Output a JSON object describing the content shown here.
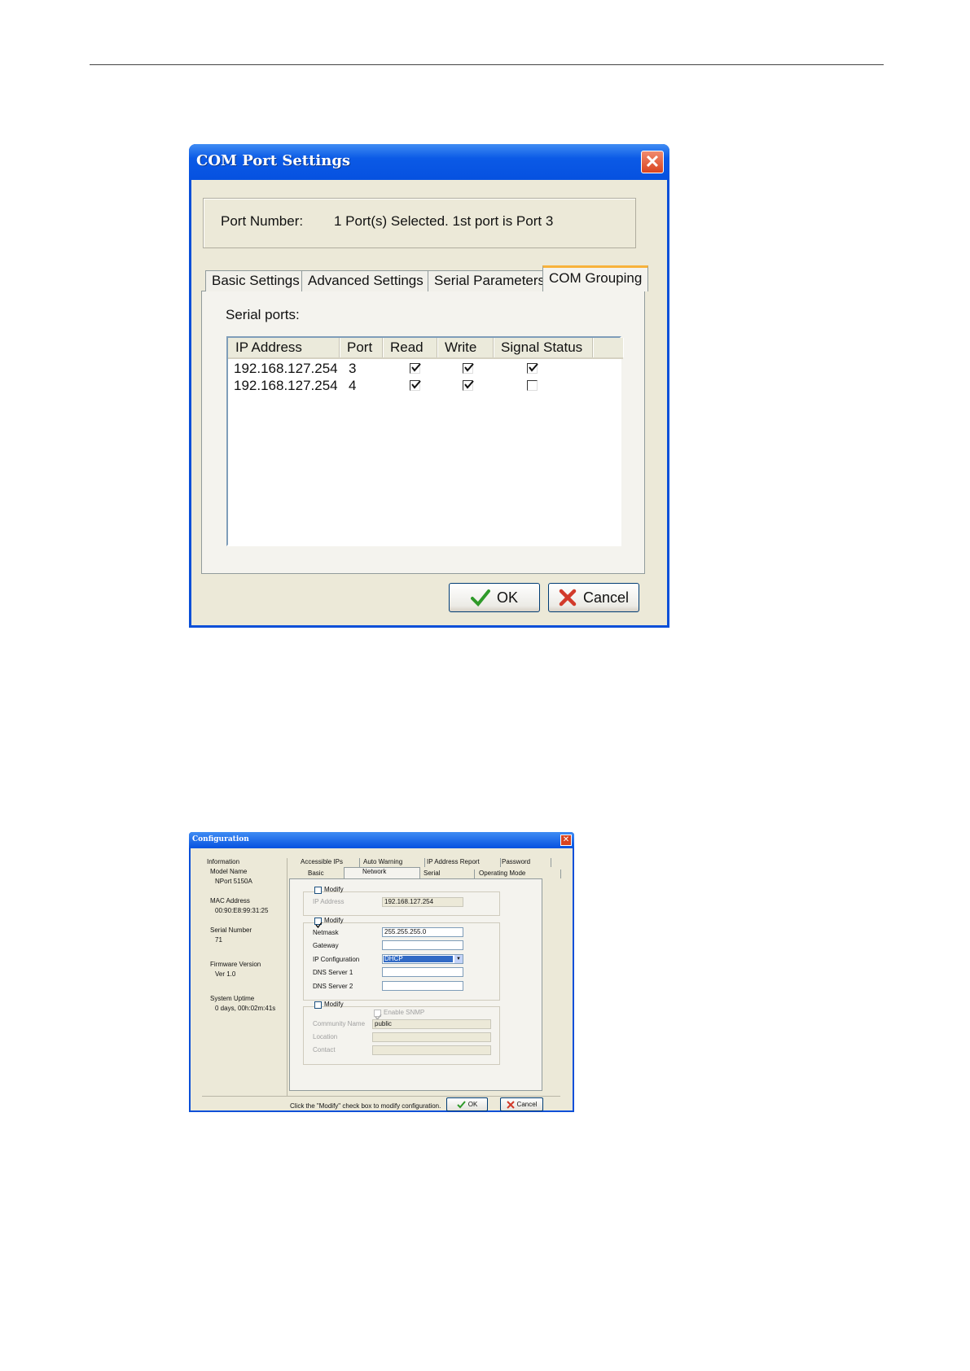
{
  "dialog1": {
    "title": "COM Port Settings",
    "port_number_label": "Port Number:",
    "port_number_value": "1 Port(s) Selected. 1st port is Port 3",
    "tabs": [
      "Basic Settings",
      "Advanced Settings",
      "Serial Parameters",
      "COM Grouping"
    ],
    "active_tab": "COM Grouping",
    "serial_ports_label": "Serial ports:",
    "columns": [
      "IP Address",
      "Port",
      "Read",
      "Write",
      "Signal Status"
    ],
    "rows": [
      {
        "ip": "192.168.127.254",
        "port": "3",
        "read": true,
        "write": true,
        "signal_status": true
      },
      {
        "ip": "192.168.127.254",
        "port": "4",
        "read": true,
        "write": true,
        "signal_status": false
      }
    ],
    "ok_label": "OK",
    "cancel_label": "Cancel"
  },
  "dialog2": {
    "title": "Configuration",
    "info": {
      "heading": "Information",
      "model_name_label": "Model Name",
      "model_name": "NPort 5150A",
      "mac_label": "MAC Address",
      "mac": "00:90:E8:99:31:25",
      "serial_label": "Serial Number",
      "serial": "71",
      "firmware_label": "Firmware Version",
      "firmware": "Ver 1.0",
      "uptime_label": "System Uptime",
      "uptime": "0 days, 00h:02m:41s"
    },
    "tabs_top": [
      "Accessible IPs",
      "Auto Warning",
      "IP Address Report",
      "Password"
    ],
    "tabs_bottom": [
      "Basic",
      "Network",
      "Serial",
      "Operating Mode"
    ],
    "active_tab": "Network",
    "modify_label": "Modify",
    "ip_address_label": "IP Address",
    "ip_address": "192.168.127.254",
    "netmask_label": "Netmask",
    "netmask": "255.255.255.0",
    "gateway_label": "Gateway",
    "ip_config_label": "IP Configuration",
    "ip_config": "DHCP",
    "dns1_label": "DNS Server 1",
    "dns2_label": "DNS Server 2",
    "enable_snmp_label": "Enable SNMP",
    "community_label": "Community Name",
    "community": "public",
    "location_label": "Location",
    "contact_label": "Contact",
    "footer_hint": "Click the \"Modify\" check box to modify configuration.",
    "ok_label": "OK",
    "cancel_label": "Cancel"
  }
}
